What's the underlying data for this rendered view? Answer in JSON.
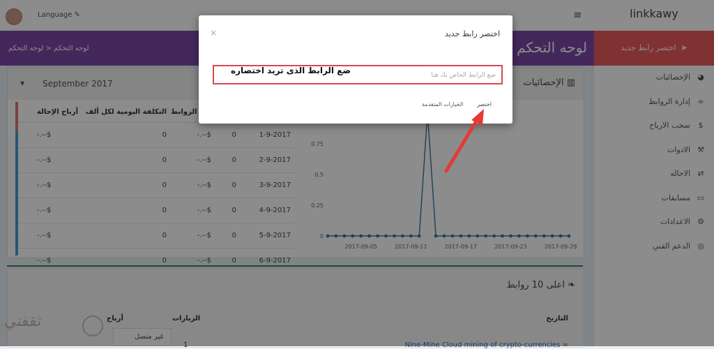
{
  "app": {
    "brand": "linkkawy",
    "language": "Language ✎"
  },
  "sidebar": {
    "cta": "اختصر رابط جديد",
    "items": [
      {
        "label": "الإحصائيات",
        "icon": "dashboard-icon"
      },
      {
        "label": "إدارة الروابط",
        "icon": "link-icon"
      },
      {
        "label": "سحب الارباح",
        "icon": "dollar-icon"
      },
      {
        "label": "الادوات",
        "icon": "wrench-icon"
      },
      {
        "label": "الاحاله",
        "icon": "exchange-icon"
      },
      {
        "label": "مسابقات",
        "icon": "ticket-icon"
      },
      {
        "label": "الاعدادات",
        "icon": "gears-icon"
      },
      {
        "label": "الدعم الفني",
        "icon": "lifebuoy-icon"
      }
    ]
  },
  "header": {
    "title": "لوحه التحكم",
    "breadcrumb": "لوحه التحكم  <  لوحه التحكم"
  },
  "stats": {
    "title": "الإحصائيات",
    "month": "September 2017",
    "columns": [
      "أرباح الإحالة",
      "التكلفة اليومية لكل ألف",
      "أرباح الروابط",
      "",
      ""
    ],
    "rows": [
      [
        "-.--$",
        "0",
        "-.--$",
        "0",
        "1-9-2017"
      ],
      [
        "-.--$",
        "0",
        "-.--$",
        "0",
        "2-9-2017"
      ],
      [
        "-.--$",
        "0",
        "-.--$",
        "0",
        "3-9-2017"
      ],
      [
        "-.--$",
        "0",
        "-.--$",
        "0",
        "4-9-2017"
      ],
      [
        "-.--$",
        "0",
        "-.--$",
        "0",
        "5-9-2017"
      ],
      [
        "-.--$",
        "0",
        "-.--$",
        "0",
        "6-9-2017"
      ]
    ]
  },
  "chart_data": {
    "type": "line",
    "x": [
      "2017-09-01",
      "2017-09-02",
      "2017-09-03",
      "2017-09-04",
      "2017-09-05",
      "2017-09-06",
      "2017-09-07",
      "2017-09-08",
      "2017-09-09",
      "2017-09-10",
      "2017-09-11",
      "2017-09-12",
      "2017-09-13",
      "2017-09-14",
      "2017-09-15",
      "2017-09-16",
      "2017-09-17",
      "2017-09-18",
      "2017-09-19",
      "2017-09-20",
      "2017-09-21",
      "2017-09-22",
      "2017-09-23",
      "2017-09-24",
      "2017-09-25",
      "2017-09-26",
      "2017-09-27",
      "2017-09-28",
      "2017-09-29",
      "2017-09-30"
    ],
    "values": [
      0,
      0,
      0,
      0,
      0,
      0,
      0,
      0,
      0,
      0,
      0,
      0,
      1,
      0,
      0,
      0,
      0,
      0,
      0,
      0,
      0,
      0,
      0,
      0,
      0,
      0,
      0,
      0,
      0,
      0
    ],
    "x_tick_labels": [
      "2017-09-05",
      "2017-09-11",
      "2017-09-17",
      "2017-09-23",
      "2017-09-29"
    ],
    "y_tick_labels": [
      "0",
      "0.25",
      "0.5",
      "0.75"
    ],
    "ylim": [
      0,
      1
    ],
    "color": "#3a7ca5"
  },
  "top_links": {
    "title": "اعلى 10 روابط",
    "col_date": "التاريخ",
    "col_visits": "الزيارات",
    "col_earn": "أرباح",
    "row_count": "1",
    "row_link": "Nine-Mine Cloud mining of crypto-currencies"
  },
  "modal": {
    "title": "اختصر رابط جديد",
    "placeholder": "ضع الرابط الخاص بك هنا",
    "annotation": "ضع الرابط الذى تريد اختصاره",
    "shorten": "اختصر",
    "advanced": "الخيارات المتقدمة",
    "close": "×"
  },
  "chat": {
    "status": "غير متصل"
  },
  "watermark": {
    "text": "ثقفني"
  },
  "colors": {
    "header": "#7d4aa8",
    "cta": "#ea5b5d",
    "annotation": "#d9474f",
    "series": "#3a7ca5"
  }
}
